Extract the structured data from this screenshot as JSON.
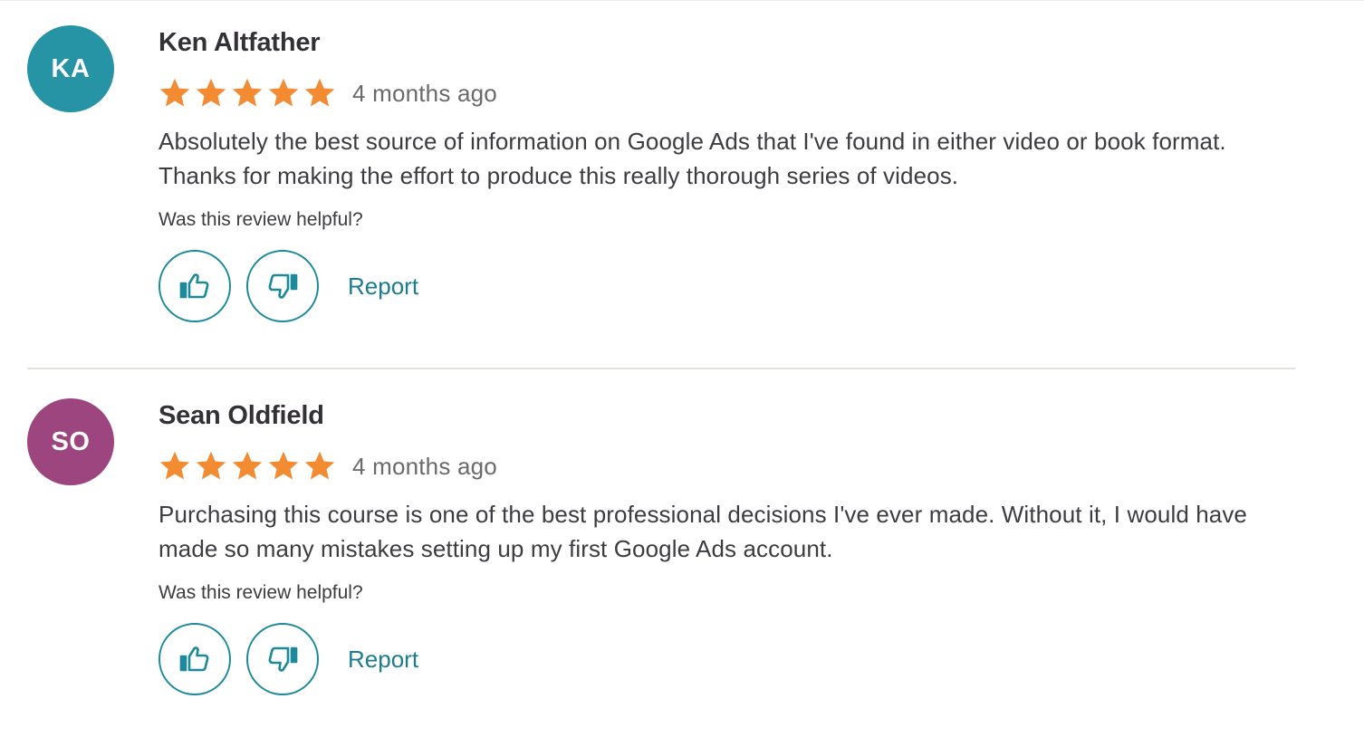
{
  "colors": {
    "star": "#f28b31",
    "accent": "#1c8a9a",
    "divider": "#e4e1dc"
  },
  "reviews": [
    {
      "initials": "KA",
      "avatar_color": "#2794a6",
      "name": "Ken Altfather",
      "rating": 5,
      "date": "4 months ago",
      "body": "Absolutely the best source of information on Google Ads that I've found in either video or book format. Thanks for making the effort to produce this really thorough series of videos.",
      "helpful_prompt": "Was this review helpful?",
      "thumbs_up_icon": "thumbs-up-icon",
      "thumbs_down_icon": "thumbs-down-icon",
      "report_label": "Report"
    },
    {
      "initials": "SO",
      "avatar_color": "#9c457e",
      "name": "Sean Oldfield",
      "rating": 5,
      "date": "4 months ago",
      "body": "Purchasing this course is one of the best professional decisions I've ever made. Without it, I would have made so many mistakes setting up my first Google Ads account.",
      "helpful_prompt": "Was this review helpful?",
      "thumbs_up_icon": "thumbs-up-icon",
      "thumbs_down_icon": "thumbs-down-icon",
      "report_label": "Report"
    }
  ]
}
